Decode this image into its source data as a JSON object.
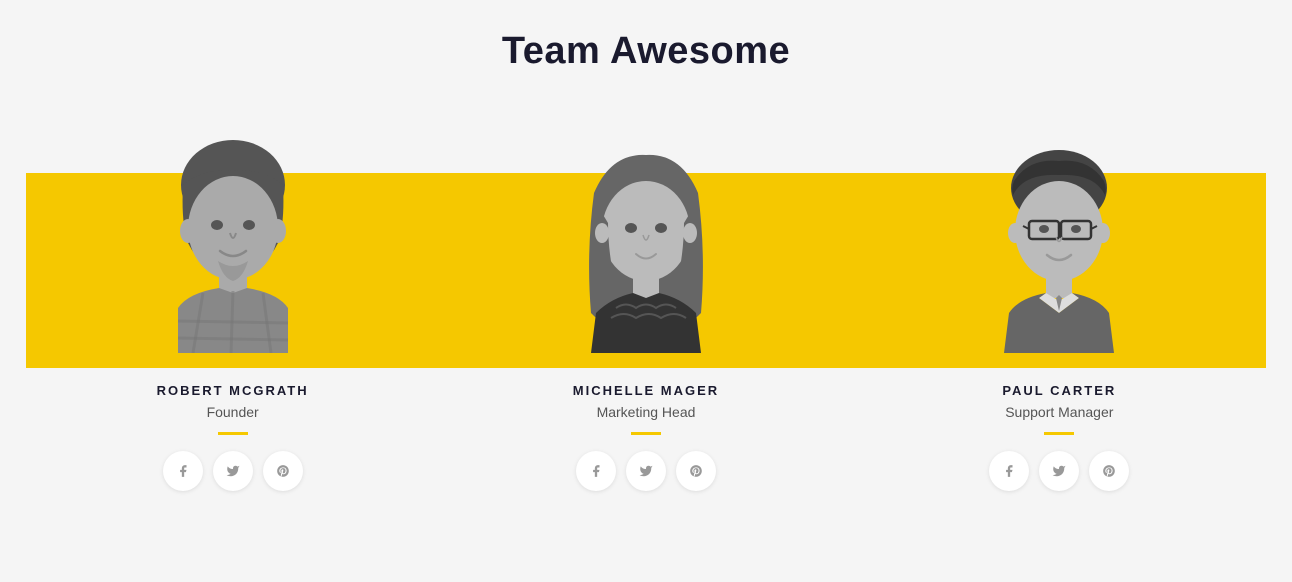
{
  "page": {
    "title": "Team Awesome",
    "background_color": "#f5f5f5",
    "accent_color": "#f5c800"
  },
  "team": {
    "members": [
      {
        "id": "robert",
        "name": "ROBERT MCGRATH",
        "role": "Founder",
        "social": [
          "facebook",
          "twitter",
          "pinterest"
        ]
      },
      {
        "id": "michelle",
        "name": "MICHELLE MAGER",
        "role": "Marketing Head",
        "social": [
          "facebook",
          "twitter",
          "pinterest"
        ]
      },
      {
        "id": "paul",
        "name": "PAUL CARTER",
        "role": "Support Manager",
        "social": [
          "facebook",
          "twitter",
          "pinterest"
        ]
      }
    ]
  },
  "icons": {
    "facebook": "f",
    "twitter": "t",
    "pinterest": "p"
  }
}
